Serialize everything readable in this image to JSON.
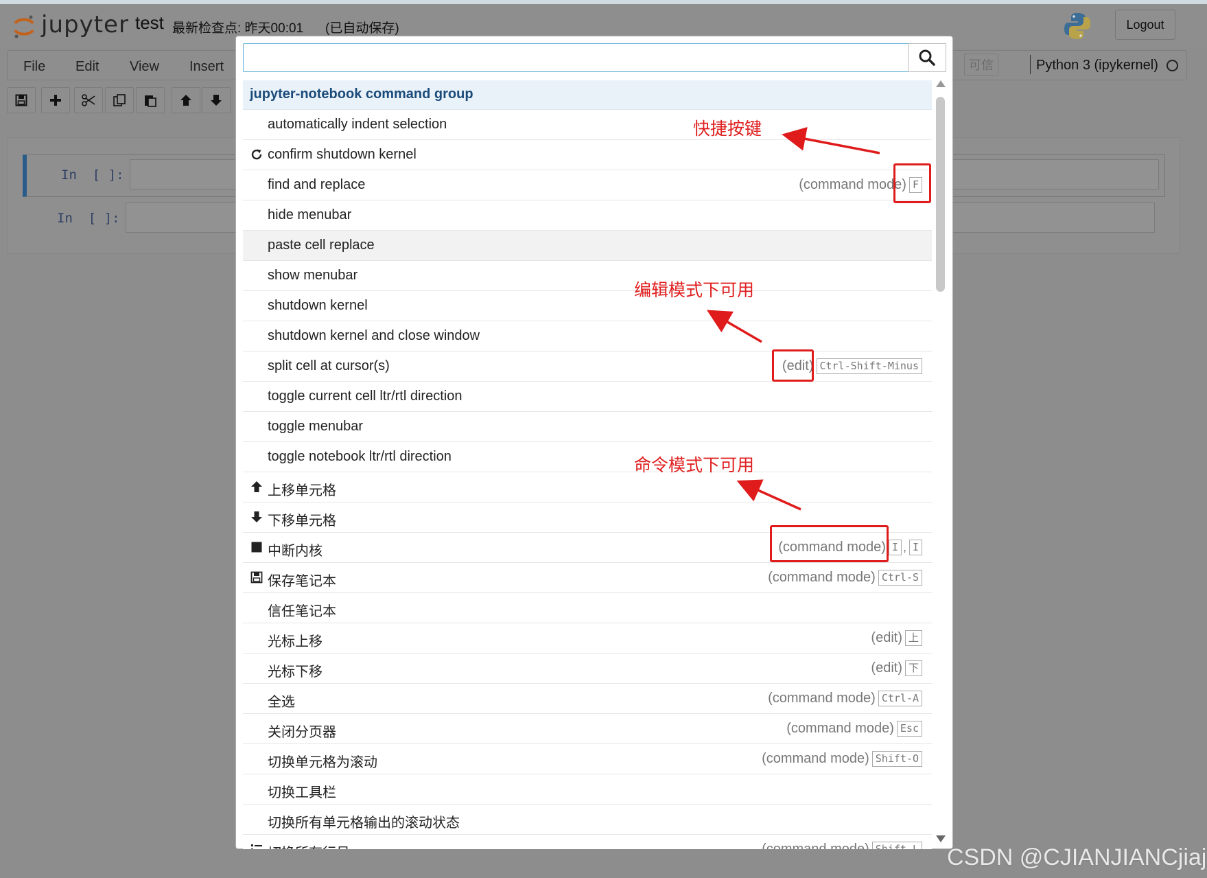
{
  "app": {
    "logo_text": "jupyter",
    "notebook_name": "test",
    "checkpoint": "最新检查点: 昨天00:01",
    "autosave": "(已自动保存)",
    "logout_label": "Logout"
  },
  "menubar": {
    "items": [
      "File",
      "Edit",
      "View",
      "Insert"
    ],
    "trusted_label": "可信",
    "kernel_name": "Python 3 (ipykernel)"
  },
  "toolbar": {
    "buttons": [
      "save-icon",
      "plus-icon",
      "cut-icon",
      "copy-icon",
      "paste-icon",
      "arrow-up-icon",
      "arrow-down-icon"
    ]
  },
  "cells": [
    {
      "prompt": "In  [ ]:"
    },
    {
      "prompt": "In  [ ]:"
    }
  ],
  "palette": {
    "search_value": "",
    "group_header": "jupyter-notebook command group",
    "rows": [
      {
        "label": "automatically indent selection",
        "icon": "",
        "mode": "",
        "keys": []
      },
      {
        "label": "confirm shutdown kernel",
        "icon": "refresh-icon",
        "mode": "",
        "keys": []
      },
      {
        "label": "find and replace",
        "icon": "",
        "mode": "(command mode)",
        "keys": [
          "F"
        ]
      },
      {
        "label": "hide menubar",
        "icon": "",
        "mode": "",
        "keys": []
      },
      {
        "label": "paste cell replace",
        "icon": "",
        "mode": "",
        "keys": [],
        "highlighted": true
      },
      {
        "label": "show menubar",
        "icon": "",
        "mode": "",
        "keys": []
      },
      {
        "label": "shutdown kernel",
        "icon": "",
        "mode": "",
        "keys": []
      },
      {
        "label": "shutdown kernel and close window",
        "icon": "",
        "mode": "",
        "keys": []
      },
      {
        "label": "split cell at cursor(s)",
        "icon": "",
        "mode": "(edit)",
        "keys": [
          "Ctrl-Shift-Minus"
        ]
      },
      {
        "label": "toggle current cell ltr/rtl direction",
        "icon": "",
        "mode": "",
        "keys": []
      },
      {
        "label": "toggle menubar",
        "icon": "",
        "mode": "",
        "keys": []
      },
      {
        "label": "toggle notebook ltr/rtl direction",
        "icon": "",
        "mode": "",
        "keys": []
      },
      {
        "label": "上移单元格",
        "icon": "arrow-up-icon",
        "mode": "",
        "keys": []
      },
      {
        "label": "下移单元格",
        "icon": "arrow-down-icon",
        "mode": "",
        "keys": []
      },
      {
        "label": "中断内核",
        "icon": "stop-icon",
        "mode": "(command mode)",
        "keys": [
          "I",
          "I"
        ]
      },
      {
        "label": "保存笔记本",
        "icon": "save-icon",
        "mode": "(command mode)",
        "keys": [
          "Ctrl-S"
        ]
      },
      {
        "label": "信任笔记本",
        "icon": "",
        "mode": "",
        "keys": []
      },
      {
        "label": "光标上移",
        "icon": "",
        "mode": "(edit)",
        "keys": [
          "上"
        ]
      },
      {
        "label": "光标下移",
        "icon": "",
        "mode": "(edit)",
        "keys": [
          "下"
        ]
      },
      {
        "label": "全选",
        "icon": "",
        "mode": "(command mode)",
        "keys": [
          "Ctrl-A"
        ]
      },
      {
        "label": "关闭分页器",
        "icon": "",
        "mode": "(command mode)",
        "keys": [
          "Esc"
        ]
      },
      {
        "label": "切换单元格为滚动",
        "icon": "",
        "mode": "(command mode)",
        "keys": [
          "Shift-O"
        ]
      },
      {
        "label": "切换工具栏",
        "icon": "",
        "mode": "",
        "keys": []
      },
      {
        "label": "切换所有单元格输出的滚动状态",
        "icon": "",
        "mode": "",
        "keys": []
      },
      {
        "label": "切换所有行号",
        "icon": "list-icon",
        "mode": "(command mode)",
        "keys": [
          "Shift-L"
        ]
      }
    ]
  },
  "annotations": {
    "shortcut_label": "快捷按键",
    "edit_mode_label": "编辑模式下可用",
    "command_mode_label": "命令模式下可用",
    "color": "#e01b1b"
  },
  "watermark": "CSDN @CJIANJIANCjiajia"
}
